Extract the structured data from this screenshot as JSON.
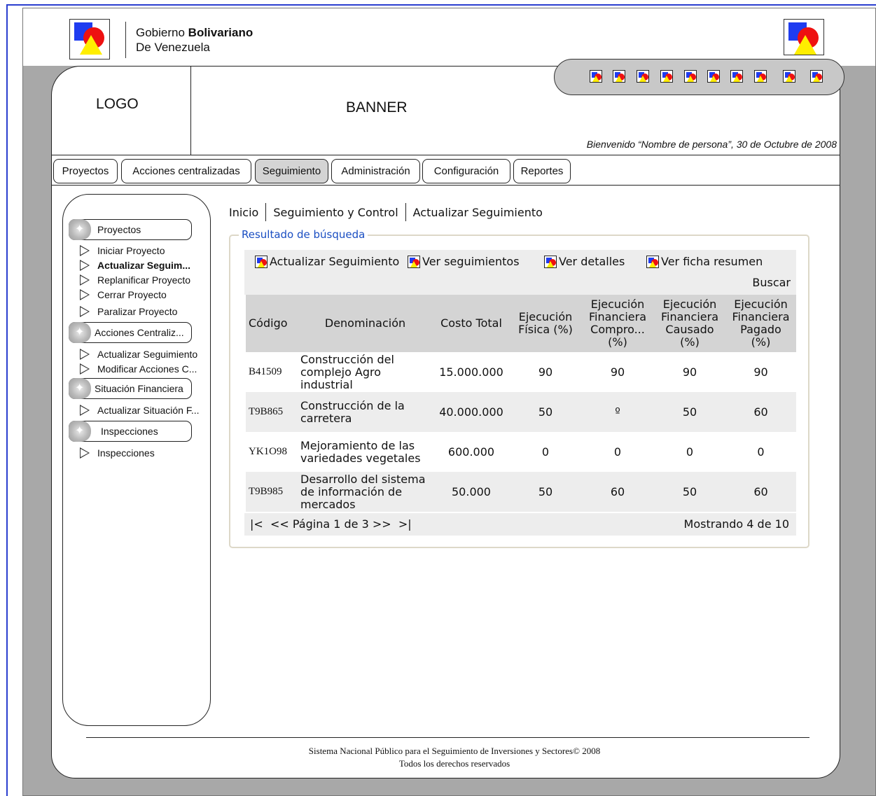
{
  "header": {
    "gov_line1_prefix": "Gobierno ",
    "gov_line1_bold": "Bolivariano",
    "gov_line2": "De Venezuela"
  },
  "banner": {
    "logo_label": "LOGO",
    "banner_label": "BANNER",
    "welcome": "Bienvenido “Nombre de persona”, 30 de Octubre de 2008"
  },
  "icon_bar": {
    "icon": "app-logo-icon",
    "count": 10
  },
  "tabs": [
    {
      "label": "Proyectos"
    },
    {
      "label": "Acciones centralizadas"
    },
    {
      "label": "Seguimiento",
      "active": true
    },
    {
      "label": "Administración"
    },
    {
      "label": "Configuración"
    },
    {
      "label": "Reportes"
    }
  ],
  "sidebar": {
    "sections": [
      {
        "label": "Proyectos",
        "items": [
          "Iniciar Proyecto",
          "Actualizar Seguim...",
          "Replanificar Proyecto",
          "Cerrar Proyecto",
          "Paralizar Proyecto"
        ]
      },
      {
        "label": "Acciones Centraliz...",
        "items": [
          "Actualizar Seguimiento",
          "Modificar Acciones C..."
        ]
      },
      {
        "label": "Situación Financiera",
        "items": [
          "Actualizar Situación F..."
        ]
      },
      {
        "label": "Inspecciones",
        "items": [
          "Inspecciones"
        ]
      }
    ]
  },
  "breadcrumb": [
    "Inicio",
    "Seguimiento y Control",
    "Actualizar Seguimiento"
  ],
  "results": {
    "legend": "Resultado de búsqueda",
    "actions": [
      "Actualizar Seguimiento",
      "Ver seguimientos",
      "Ver detalles",
      "Ver ficha resumen"
    ],
    "search_label": "Buscar",
    "columns": [
      [
        "Código"
      ],
      [
        "Denominación"
      ],
      [
        "Costo Total"
      ],
      [
        "Ejecución",
        "Física (%)"
      ],
      [
        "Ejecución",
        "Financiera",
        "Compro...",
        "(%)"
      ],
      [
        "Ejecución",
        "Financiera",
        "Causado",
        "(%)"
      ],
      [
        "Ejecución",
        "Financiera",
        "Pagado",
        "(%)"
      ]
    ],
    "rows": [
      {
        "code": "B41509",
        "name": [
          "Construcción del",
          "complejo Agro",
          "industrial"
        ],
        "cost": "15.000.000",
        "fisica": "90",
        "compro": "90",
        "causado": "90",
        "pagado": "90"
      },
      {
        "code": "T9B865",
        "name": [
          "Construcción de la",
          "carretera"
        ],
        "cost": "40.000.000",
        "fisica": "50",
        "compro": "º",
        "causado": "50",
        "pagado": "60"
      },
      {
        "code": "YK1O98",
        "name": [
          "Mejoramiento de las",
          "variedades vegetales"
        ],
        "cost": "600.000",
        "fisica": "0",
        "compro": "0",
        "causado": "0",
        "pagado": "0"
      },
      {
        "code": "T9B985",
        "name": [
          "Desarrollo del sistema",
          "de información de",
          "mercados"
        ],
        "cost": "50.000",
        "fisica": "50",
        "compro": "60",
        "causado": "50",
        "pagado": "60"
      }
    ],
    "pager": {
      "first": "|<",
      "prev": "<<",
      "page_text": "Página 1 de 3",
      "next": ">>",
      "last": ">|"
    },
    "showing": "Mostrando 4 de 10"
  },
  "footer": {
    "line1": "Sistema Nacional Público para el Seguimiento de Inversiones y Sectores© 2008",
    "line2": "Todos los derechos reservados"
  },
  "colors": {
    "link_blue": "#1a4ec2",
    "frame_blue": "#2a3ecf",
    "gray_bg": "#a8a8a8"
  }
}
